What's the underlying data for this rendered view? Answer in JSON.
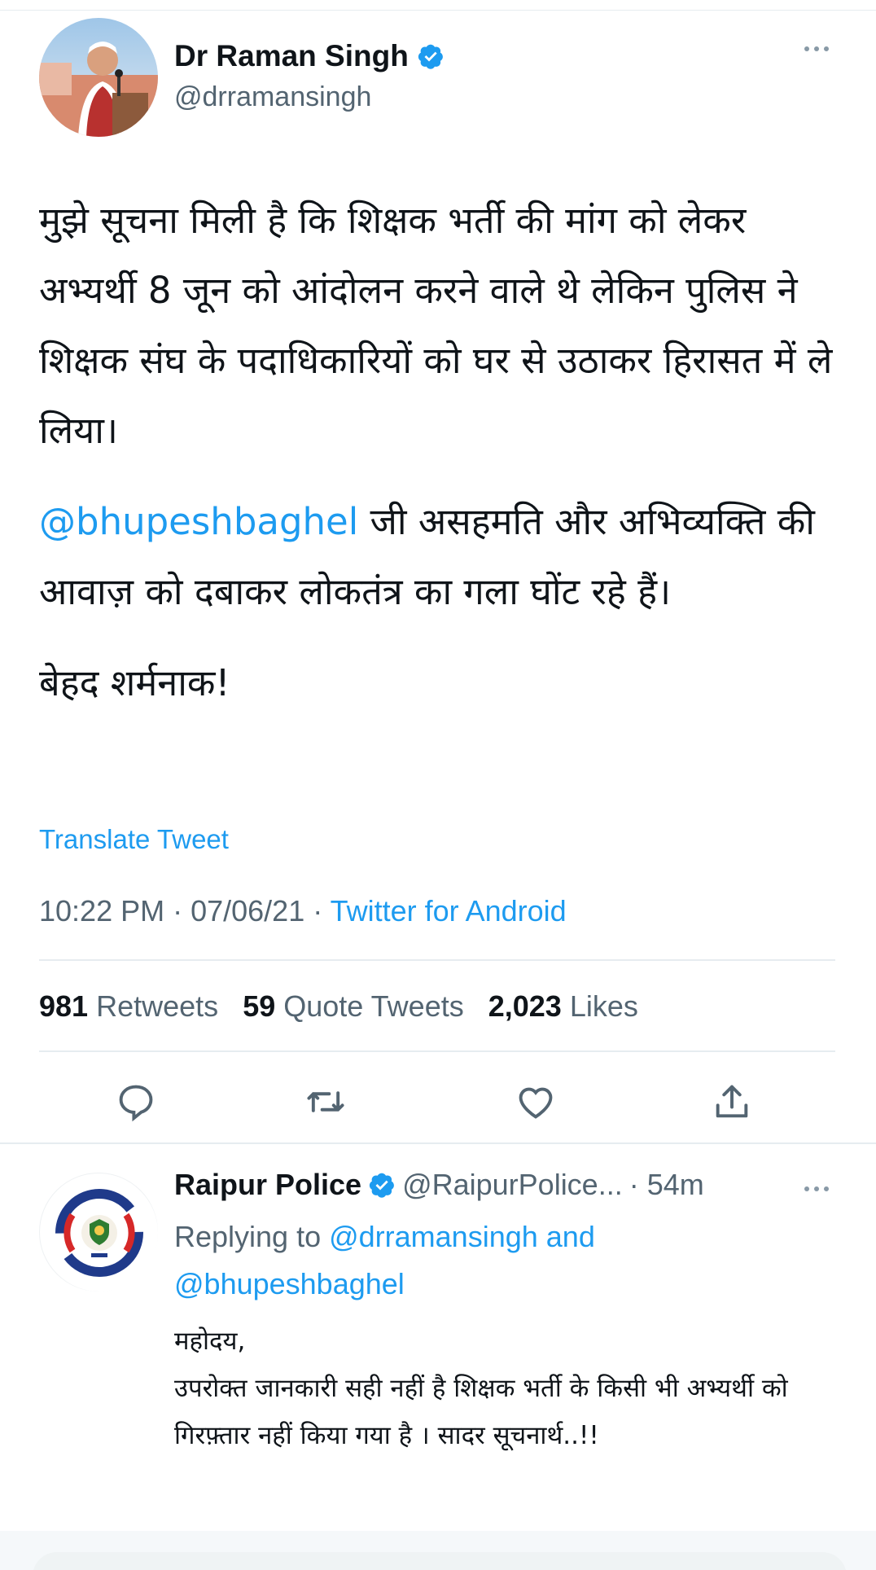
{
  "main_tweet": {
    "author_name": "Dr Raman Singh",
    "author_handle": "@drramansingh",
    "paragraphs": [
      {
        "text": "मुझे सूचना मिली है कि शिक्षक भर्ती की मांग को लेकर अभ्यर्थी 8 जून को आंदोलन करने वाले थे लेकिन पुलिस ने शिक्षक संघ के पदाधिकारियों को घर से उठाकर हिरासत में ले लिया।"
      },
      {
        "mention": "@bhupeshbaghel",
        "text": " जी असहमति और अभिव्यक्ति की आवाज़ को दबाकर लोकतंत्र का गला घोंट रहे हैं।"
      },
      {
        "text": "बेहद शर्मनाक!"
      }
    ],
    "translate_label": "Translate Tweet",
    "timestamp": "10:22 PM · 07/06/21 · ",
    "source": "Twitter for Android",
    "stats": {
      "retweets_count": "981",
      "retweets_label": "Retweets",
      "quotes_count": "59",
      "quotes_label": "Quote Tweets",
      "likes_count": "2,023",
      "likes_label": "Likes"
    },
    "actions": [
      "reply-icon",
      "retweet-icon",
      "like-icon",
      "share-icon"
    ]
  },
  "reply_tweet": {
    "author_name": "Raipur Police",
    "author_handle": "@RaipurPolice...",
    "time": "· 54m",
    "replying_prefix": "Replying to ",
    "replying_mention_1": "@drramansingh",
    "replying_and": " and",
    "replying_mention_2": "@bhupeshbaghel",
    "lines": [
      "महोदय,",
      "उपरोक्त जानकारी सही नहीं है शिक्षक भर्ती के किसी भी अभ्यर्थी को गिरफ़्तार नहीं किया गया है । सादर सूचनार्थ..!!"
    ]
  },
  "colors": {
    "accent": "#1d9bf0",
    "text": "#0f1419",
    "muted": "#536471",
    "divider": "#e6ecf0"
  }
}
